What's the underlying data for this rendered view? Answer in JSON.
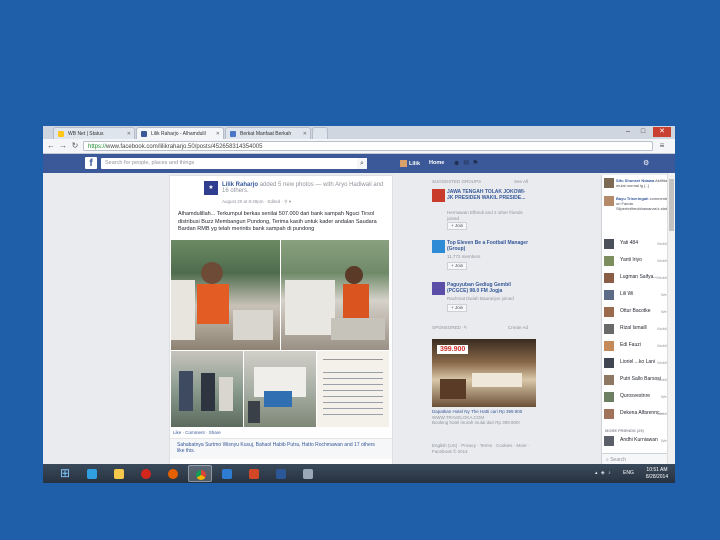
{
  "browser": {
    "tabs": [
      {
        "label": "WB Net | Status",
        "color": "#ffc61a"
      },
      {
        "label": "Lilik Raharjo - Alhamdulil",
        "color": "#3b5998"
      },
      {
        "label": "Berkat Manfaat Berkah",
        "color": "#4a76c7"
      }
    ],
    "url_scheme": "https://",
    "url_rest": "www.facebook.com/lilikraharjo.50/posts/452658314354005"
  },
  "fb": {
    "logo": "f",
    "search_placeholder": "Search for people, places and things",
    "user": "Lilik",
    "home": "Home",
    "brand_color": "#3b5998"
  },
  "post": {
    "avatar_text": "★",
    "author": "Lilik Raharjo",
    "action": "added 5 new photos —",
    "with_text": "with Aryo Hadiwali and",
    "others": "16 others.",
    "meta": "August 20 at 8:49pm · Edited · ⚲ ▾",
    "text": "Alhamdulillah... Terkumpul berkas senilai 507.000 dari bank sampah Nguci Tirsol distribusi Buzz Membangun Pundong, Terima kasih untuk kader andalan Saudara Bardan RMB yg telah merintis bank sampah di pundong",
    "actions": "Like · Comment · Share",
    "likes": "Sahabatnya Surtmo Wisnyu Kusuj, Bahaol Habib Putra, Hatto Rochmawan and 17 others like this."
  },
  "sidebar": {
    "heading": "SUGGESTED GROUPS",
    "see_all": "See All",
    "suggestions": [
      {
        "name": "JAWA TENGAH TOLAK JOKOWI-JK PRESIDEN WAKIL PRESIDE...",
        "sub": "Hermawan Effendi and 2 other friends joined",
        "join": "+ Join"
      },
      {
        "name": "Top Eleven Be a Football Manager (Group)",
        "sub": "11,772 members",
        "join": "+ Join"
      },
      {
        "name": "Paguyuban Gediug Gembil (PCGCE) 98.0 FM Jogja",
        "sub": "Rachmat Dwiah Baaranjon joined",
        "join": "+ Join"
      }
    ],
    "sponsored": "SPONSORED ·✎",
    "create_ad": "Create Ad",
    "ad_price": "399.900",
    "ad_title": "Dapatkan Hotel Ny The Hatti cari Rp 399.900",
    "ad_url": "WWW.TRAVELOKA.COM",
    "ad_desc": "Booking hotel murah mulai dari Rp 399.900!",
    "footer": "English (US) · Privacy · Terms · Cookies · More · Facebook © 2014"
  },
  "chat": {
    "ticker": [
      {
        "text_b": "Sifu Shunsei Ndawa",
        "text": "Aktifitas mulai normal lg [..]"
      },
      {
        "text_b": "Bayu Triseringah",
        "text": "commented on Farida Silperbritheobhawanas's status."
      }
    ],
    "contacts": [
      {
        "name": "Yati 484",
        "status": "Mobile"
      },
      {
        "name": "Yanti Iriyo",
        "status": "Mobile"
      },
      {
        "name": "Lugman Saifya...",
        "status": "Mobile"
      },
      {
        "name": "Lili Wi",
        "status": "Web"
      },
      {
        "name": "Ottur Bacotke",
        "status": "Web"
      },
      {
        "name": "Rizal Ismaill",
        "status": "Mobile"
      },
      {
        "name": "Edi Fauzi",
        "status": "Mobile"
      },
      {
        "name": "Lioriel ...ko Lani",
        "status": "Mobile"
      }
    ],
    "more_label": "MORE FRIENDS (29)",
    "more_contacts": [
      {
        "name": "Putri Sallo Barsosi",
        "status": "Mobile"
      },
      {
        "name": "Qurosvestnre",
        "status": "Web"
      },
      {
        "name": "Dekena Alfarennc...",
        "status": "Mobile"
      }
    ],
    "more_label2": "MORE FRIENDS (29)",
    "last_contact": {
      "name": "Andhi Kurniawan",
      "status": "Web"
    },
    "search": "Search"
  },
  "taskbar": {
    "apps": [
      {
        "name": "ie",
        "color": "#2f9fe0"
      },
      {
        "name": "explorer",
        "color": "#f3c84b"
      },
      {
        "name": "opera",
        "color": "#d3271d"
      },
      {
        "name": "firefox",
        "color": "#e66000"
      },
      {
        "name": "chrome",
        "color": "#4caf50"
      },
      {
        "name": "publisher",
        "color": "#2e7dd1"
      },
      {
        "name": "powerpoint",
        "color": "#d24726"
      },
      {
        "name": "word",
        "color": "#2b5797"
      },
      {
        "name": "network",
        "color": "#9aa8b8"
      }
    ],
    "lang": "ENG",
    "time": "10:51 AM",
    "date": "8/28/2014"
  }
}
